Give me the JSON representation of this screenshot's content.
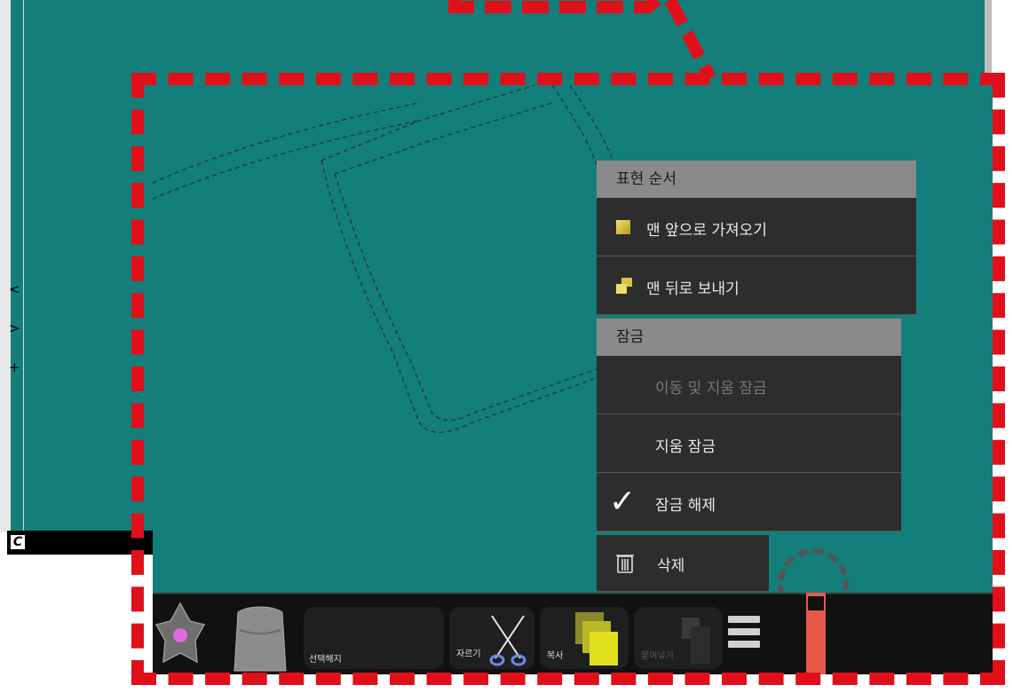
{
  "side_buttons": {
    "prev": "<",
    "next": ">",
    "add": "+"
  },
  "corner_icon": "C",
  "menu": {
    "order_header": "표현 순서",
    "bring_front": "맨 앞으로 가져오기",
    "send_back": "맨 뒤로 보내기",
    "lock_header": "잠금",
    "lock_move_erase": "이동 및 지움 잠금",
    "lock_erase": "지움 잠금",
    "unlock": "잠금 해제",
    "delete": "삭제"
  },
  "toolbar": {
    "deselect": "선택해지",
    "cut": "자르기",
    "copy": "복사",
    "paste": "붙여넣기"
  },
  "icons": {
    "bring_front": "square-icon",
    "send_back": "layer-back-icon",
    "unlock": "check-icon",
    "delete": "trash-icon",
    "pen": "star-pen-icon",
    "eraser": "eraser-icon",
    "cut": "scissors-icon",
    "copy": "copy-icon",
    "paste": "paste-icon",
    "menu": "hamburger-icon"
  },
  "colors": {
    "board": "#147e7b",
    "highlight_frame": "#e0101a",
    "menu_header": "#8a8a8a",
    "menu_item": "#2d2d2d",
    "toolbar": "#111111",
    "slider": "#e85a4a"
  }
}
